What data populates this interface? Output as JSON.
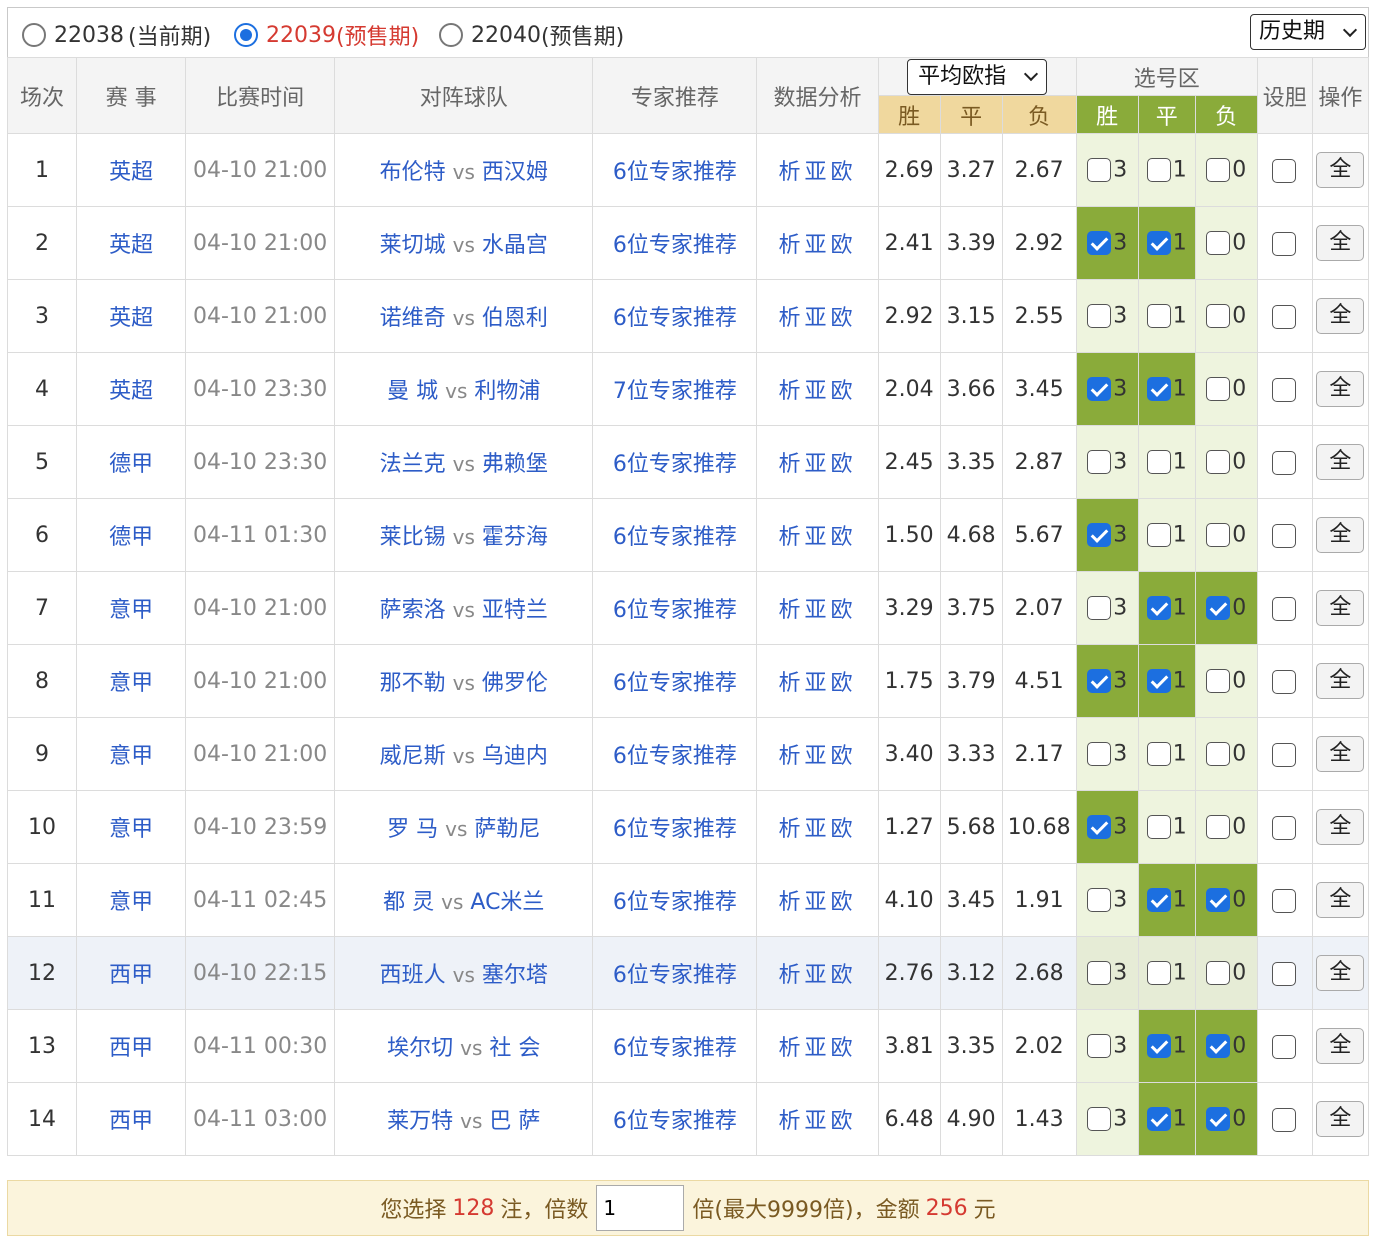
{
  "periods": [
    {
      "label": "22038",
      "suffix": "(当前期)",
      "selected": false
    },
    {
      "label": "22039",
      "suffix": "(预售期)",
      "selected": true
    },
    {
      "label": "22040",
      "suffix": "(预售期)",
      "selected": false
    }
  ],
  "history_select": "历史期",
  "headers": {
    "no": "场次",
    "league": "赛 事",
    "time": "比赛时间",
    "teams": "对阵球队",
    "expert": "专家推荐",
    "analysis": "数据分析",
    "odds_select": "平均欧指",
    "odds_win": "胜",
    "odds_draw": "平",
    "odds_lose": "负",
    "pick_zone": "选号区",
    "pick_win": "胜",
    "pick_draw": "平",
    "pick_lose": "负",
    "dan": "设胆",
    "op": "操作"
  },
  "rows": [
    {
      "no": "1",
      "league": "英超",
      "time": "04-10 21:00",
      "home": "布伦特",
      "vs": "vs",
      "away": "西汉姆",
      "expert": "6位专家推荐",
      "ana": "析亚欧",
      "w": "2.69",
      "d": "3.27",
      "l": "2.67",
      "p3": false,
      "p1": false,
      "p0": false,
      "all": "全"
    },
    {
      "no": "2",
      "league": "英超",
      "time": "04-10 21:00",
      "home": "莱切城",
      "vs": "vs",
      "away": "水晶宫",
      "expert": "6位专家推荐",
      "ana": "析亚欧",
      "w": "2.41",
      "d": "3.39",
      "l": "2.92",
      "p3": true,
      "p1": true,
      "p0": false,
      "all": "全"
    },
    {
      "no": "3",
      "league": "英超",
      "time": "04-10 21:00",
      "home": "诺维奇",
      "vs": "vs",
      "away": "伯恩利",
      "expert": "6位专家推荐",
      "ana": "析亚欧",
      "w": "2.92",
      "d": "3.15",
      "l": "2.55",
      "p3": false,
      "p1": false,
      "p0": false,
      "all": "全"
    },
    {
      "no": "4",
      "league": "英超",
      "time": "04-10 23:30",
      "home": "曼 城",
      "vs": "vs",
      "away": "利物浦",
      "expert": "7位专家推荐",
      "ana": "析亚欧",
      "w": "2.04",
      "d": "3.66",
      "l": "3.45",
      "p3": true,
      "p1": true,
      "p0": false,
      "all": "全"
    },
    {
      "no": "5",
      "league": "德甲",
      "time": "04-10 23:30",
      "home": "法兰克",
      "vs": "vs",
      "away": "弗赖堡",
      "expert": "6位专家推荐",
      "ana": "析亚欧",
      "w": "2.45",
      "d": "3.35",
      "l": "2.87",
      "p3": false,
      "p1": false,
      "p0": false,
      "all": "全"
    },
    {
      "no": "6",
      "league": "德甲",
      "time": "04-11 01:30",
      "home": "莱比锡",
      "vs": "vs",
      "away": "霍芬海",
      "expert": "6位专家推荐",
      "ana": "析亚欧",
      "w": "1.50",
      "d": "4.68",
      "l": "5.67",
      "p3": true,
      "p1": false,
      "p0": false,
      "all": "全"
    },
    {
      "no": "7",
      "league": "意甲",
      "time": "04-10 21:00",
      "home": "萨索洛",
      "vs": "vs",
      "away": "亚特兰",
      "expert": "6位专家推荐",
      "ana": "析亚欧",
      "w": "3.29",
      "d": "3.75",
      "l": "2.07",
      "p3": false,
      "p1": true,
      "p0": true,
      "all": "全"
    },
    {
      "no": "8",
      "league": "意甲",
      "time": "04-10 21:00",
      "home": "那不勒",
      "vs": "vs",
      "away": "佛罗伦",
      "expert": "6位专家推荐",
      "ana": "析亚欧",
      "w": "1.75",
      "d": "3.79",
      "l": "4.51",
      "p3": true,
      "p1": true,
      "p0": false,
      "all": "全"
    },
    {
      "no": "9",
      "league": "意甲",
      "time": "04-10 21:00",
      "home": "威尼斯",
      "vs": "vs",
      "away": "乌迪内",
      "expert": "6位专家推荐",
      "ana": "析亚欧",
      "w": "3.40",
      "d": "3.33",
      "l": "2.17",
      "p3": false,
      "p1": false,
      "p0": false,
      "all": "全"
    },
    {
      "no": "10",
      "league": "意甲",
      "time": "04-10 23:59",
      "home": "罗 马",
      "vs": "vs",
      "away": "萨勒尼",
      "expert": "6位专家推荐",
      "ana": "析亚欧",
      "w": "1.27",
      "d": "5.68",
      "l": "10.68",
      "p3": true,
      "p1": false,
      "p0": false,
      "all": "全"
    },
    {
      "no": "11",
      "league": "意甲",
      "time": "04-11 02:45",
      "home": "都 灵",
      "vs": "vs",
      "away": "AC米兰",
      "expert": "6位专家推荐",
      "ana": "析亚欧",
      "w": "4.10",
      "d": "3.45",
      "l": "1.91",
      "p3": false,
      "p1": true,
      "p0": true,
      "all": "全"
    },
    {
      "no": "12",
      "league": "西甲",
      "time": "04-10 22:15",
      "home": "西班人",
      "vs": "vs",
      "away": "塞尔塔",
      "expert": "6位专家推荐",
      "ana": "析亚欧",
      "w": "2.76",
      "d": "3.12",
      "l": "2.68",
      "p3": false,
      "p1": false,
      "p0": false,
      "all": "全",
      "alt": true
    },
    {
      "no": "13",
      "league": "西甲",
      "time": "04-11 00:30",
      "home": "埃尔切",
      "vs": "vs",
      "away": "社 会",
      "expert": "6位专家推荐",
      "ana": "析亚欧",
      "w": "3.81",
      "d": "3.35",
      "l": "2.02",
      "p3": false,
      "p1": true,
      "p0": true,
      "all": "全"
    },
    {
      "no": "14",
      "league": "西甲",
      "time": "04-11 03:00",
      "home": "莱万特",
      "vs": "vs",
      "away": "巴 萨",
      "expert": "6位专家推荐",
      "ana": "析亚欧",
      "w": "6.48",
      "d": "4.90",
      "l": "1.43",
      "p3": false,
      "p1": true,
      "p0": true,
      "all": "全"
    }
  ],
  "footer": {
    "t1": "您选择",
    "bets": "128",
    "t2": "注，倍数",
    "multiplier": "1",
    "t3": "倍(最大9999倍)，金额",
    "amount": "256",
    "t4": "元"
  }
}
